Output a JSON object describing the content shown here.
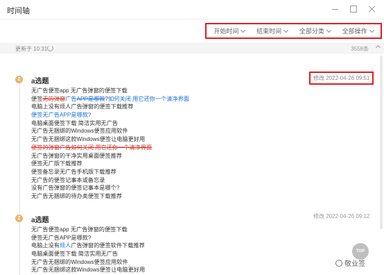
{
  "window": {
    "title": "时间轴"
  },
  "toolbar": [
    {
      "label": "开始时间"
    },
    {
      "label": "结束时间"
    },
    {
      "label": "全部分类"
    },
    {
      "label": "全部操作"
    }
  ],
  "status": {
    "updated": "更新于 10:31",
    "count": "3558条"
  },
  "entries": [
    {
      "avatar": "Z",
      "title": "a选题",
      "date": "修改 2022-04-26 09:51",
      "lines": [
        [
          {
            "t": "无广告便签app 无广告弹窗的便签下载"
          }
        ],
        [
          {
            "t": "便签",
            "c": ""
          },
          {
            "t": "无的弹窗",
            "c": "red strike"
          },
          {
            "t": "广告",
            "c": "link"
          },
          {
            "t": "APP是哪款",
            "c": "link strike"
          },
          {
            "t": "?",
            "c": ""
          },
          {
            "t": "如何关闭 用它还你一个清净界面",
            "c": "link"
          }
        ],
        [
          {
            "t": "电脑上没有烦人广告弹窗的便签下载推荐"
          }
        ],
        [
          {
            "t": "便签无广告APP是哪款?",
            "c": "link"
          }
        ],
        [
          {
            "t": "电脑桌面便签下载 简洁实用无广告"
          }
        ],
        [
          {
            "t": "无广告无捆绑的Windows便签应用软件"
          }
        ],
        [
          {
            "t": "无广告无捆绑这款Windows便签让电脑更好用"
          }
        ],
        [
          {
            "t": "便签的弹窗广告如何关闭 用它还你一个清净界面",
            "c": "strike-red"
          }
        ],
        [
          {
            "t": "无广告弹窗的干净实用桌面便签推荐"
          }
        ],
        [
          {
            "t": "便签无广版下载推荐"
          }
        ],
        [
          {
            "t": "便签备忘录无广告手机版下载推荐"
          }
        ],
        [
          {
            "t": "无广告的便签记事本或备忘录"
          }
        ],
        [
          {
            "t": "没有广告弹窗的便签记事本是哪个?"
          }
        ],
        [
          {
            "t": "无广告无捆绑的待办类便签下载推荐"
          }
        ]
      ]
    },
    {
      "avatar": "Z",
      "title": "a选题",
      "date": "修改 2022-04-26 09:12",
      "lines": [
        [
          {
            "t": "无广告便签app 无广告弹窗的便签下载"
          }
        ],
        [
          {
            "t": "便签无广告APP是哪款?"
          }
        ],
        [
          {
            "t": "电脑上没有"
          },
          {
            "t": "烦人",
            "c": "link"
          },
          {
            "t": "广告弹窗的便签软件下载推荐"
          }
        ],
        [
          {
            "t": "电脑桌面便签下载 简洁实用无广告"
          }
        ],
        [
          {
            "t": "无广告无捆绑的Windows便签应用软件"
          }
        ],
        [
          {
            "t": "无广告无捆绑这款Windows便签让电脑更好用"
          }
        ]
      ]
    }
  ],
  "scroll_top": "TOP",
  "watermark": "敬业签"
}
